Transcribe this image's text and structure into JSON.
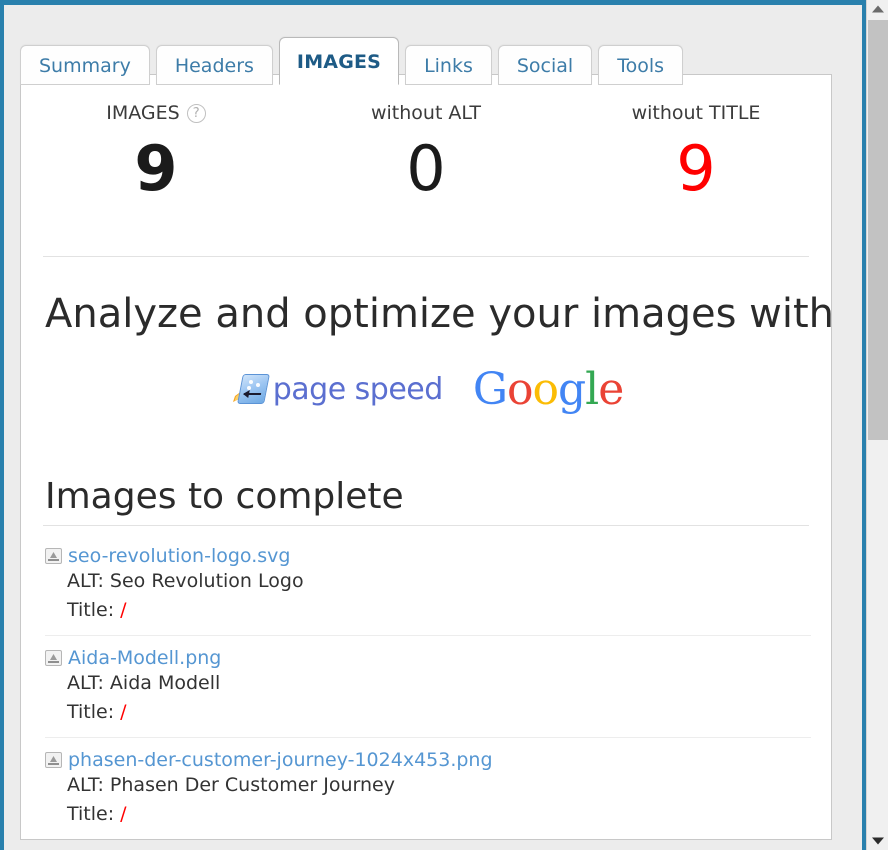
{
  "window": {
    "accent_border_color": "#2980ad",
    "panel_bg": "#ececec"
  },
  "tabs": [
    {
      "id": "summary",
      "label": "Summary",
      "active": false
    },
    {
      "id": "headers",
      "label": "Headers",
      "active": false
    },
    {
      "id": "images",
      "label": "IMAGES",
      "active": true
    },
    {
      "id": "links",
      "label": "Links",
      "active": false
    },
    {
      "id": "social",
      "label": "Social",
      "active": false
    },
    {
      "id": "tools",
      "label": "Tools",
      "active": false
    }
  ],
  "stats": [
    {
      "id": "images",
      "label": "IMAGES",
      "value": "9",
      "help_icon": "?",
      "has_help": true,
      "style": "bold",
      "color": "#1b1b1b"
    },
    {
      "id": "without-alt",
      "label": "without ALT",
      "value": "0",
      "has_help": false,
      "style": "normal",
      "color": "#1b1b1b"
    },
    {
      "id": "without-title",
      "label": "without TITLE",
      "value": "9",
      "has_help": false,
      "style": "danger",
      "color": "#ff0000"
    }
  ],
  "promo": {
    "heading": "Analyze and optimize your images with",
    "pagespeed": {
      "icon_name": "pagespeed-icon",
      "wordmark": "page speed",
      "wordmark_color": "#5b6fd0"
    },
    "google": {
      "letters": [
        {
          "char": "G",
          "color": "#4285f4"
        },
        {
          "char": "o",
          "color": "#ea4335"
        },
        {
          "char": "o",
          "color": "#fbbc05"
        },
        {
          "char": "g",
          "color": "#4285f4"
        },
        {
          "char": "l",
          "color": "#34a853"
        },
        {
          "char": "e",
          "color": "#ea4335"
        }
      ],
      "text": "Google"
    }
  },
  "list": {
    "heading": "Images to complete",
    "alt_prefix": "ALT:",
    "title_prefix": "Title:",
    "items": [
      {
        "filename": "seo-revolution-logo.svg",
        "alt_label": "ALT:",
        "alt_value": "Seo Revolution Logo",
        "alt_full": "ALT: Seo Revolution Logo",
        "title_label": "Title:",
        "title_value": "/"
      },
      {
        "filename": "Aida-Modell.png",
        "alt_label": "ALT:",
        "alt_value": "Aida Modell",
        "alt_full": "ALT: Aida Modell",
        "title_label": "Title:",
        "title_value": "/"
      },
      {
        "filename": "phasen-der-customer-journey-1024x453.png",
        "alt_label": "ALT:",
        "alt_value": "Phasen Der Customer Journey",
        "alt_full": "ALT: Phasen Der Customer Journey",
        "title_label": "Title:",
        "title_value": "/"
      }
    ]
  },
  "scrollbar": {
    "up_arrow_icon": "triangle-up-icon",
    "down_arrow_icon": "triangle-down-icon",
    "thumb_name": "scroll-thumb"
  }
}
